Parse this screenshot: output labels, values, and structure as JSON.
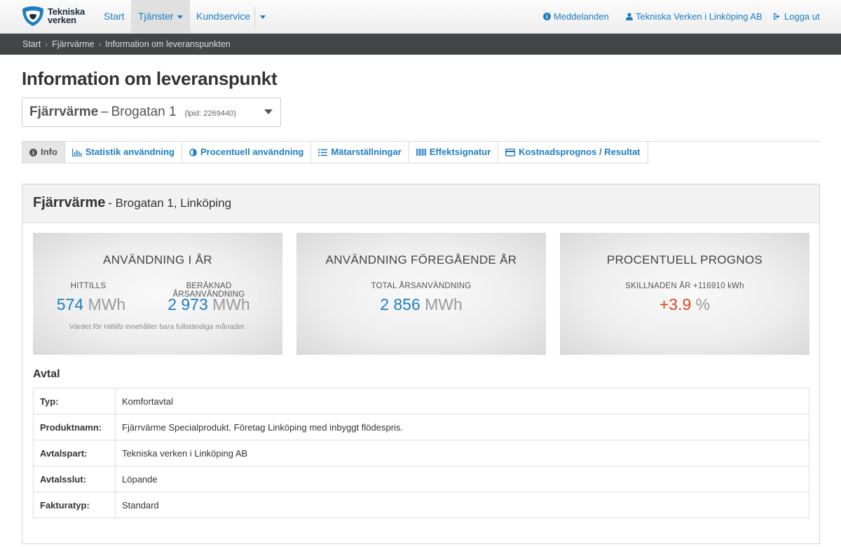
{
  "brand": {
    "logo_line1": "Tekniska",
    "logo_line2": "verken",
    "logo_colors": {
      "blue": "#1f7dc1",
      "dark": "#1b2a3c"
    }
  },
  "nav": {
    "start": "Start",
    "services": "Tjänster",
    "customer_service": "Kundservice",
    "messages": "Meddelanden",
    "account": "Tekniska Verken i Linköping AB",
    "logout": "Logga ut"
  },
  "breadcrumb": [
    "Start",
    "Fjärrvärme",
    "Information om leveranspunkten"
  ],
  "page": {
    "title": "Information om leveranspunkt",
    "selector": {
      "product": "Fjärrvärme",
      "dash": "–",
      "address": "Brogatan 1",
      "id_label": "(lpid: 2269440)"
    }
  },
  "tabs": [
    {
      "label": "Info",
      "icon": "info-icon",
      "active": true
    },
    {
      "label": "Statistik användning",
      "icon": "bar-chart-icon"
    },
    {
      "label": "Procentuell användning",
      "icon": "half-circle-icon"
    },
    {
      "label": "Mätarställningar",
      "icon": "list-icon"
    },
    {
      "label": "Effektsignatur",
      "icon": "barcode-icon"
    },
    {
      "label": "Kostnadsprognos / Resultat",
      "icon": "credit-card-icon"
    }
  ],
  "panel": {
    "title": "Fjärrvärme",
    "subtitle": "- Brogatan 1, Linköping"
  },
  "stats": {
    "current": {
      "title": "ANVÄNDNING I ÅR",
      "to_date_label": "HITTILLS",
      "to_date_value": "574",
      "to_date_unit": "MWh",
      "estimated_label": "BERÄKNAD ÅRSANVÄNDNING",
      "estimated_value": "2 973",
      "estimated_unit": "MWh",
      "note_prefix": "Värdet för",
      "note_em": "Hittills",
      "note_suffix": "innehåller bara fullständiga månader."
    },
    "previous": {
      "title": "ANVÄNDNING FÖREGÅENDE ÅR",
      "label": "TOTAL ÅRSANVÄNDNING",
      "value": "2 856",
      "unit": "MWh"
    },
    "forecast": {
      "title": "PROCENTUELL PROGNOS",
      "label": "SKILLNADEN ÅR +116910 kWh",
      "value": "+3.9",
      "unit": "%",
      "value_color": "#d9471c"
    }
  },
  "contract": {
    "heading": "Avtal",
    "rows": [
      {
        "key": "Typ:",
        "value": "Komfortavtal"
      },
      {
        "key": "Produktnamn:",
        "value": "Fjärrvärme Specialprodukt. Företag Linköping med inbyggt flödespris."
      },
      {
        "key": "Avtalspart:",
        "value": "Tekniska verken i Linköping AB"
      },
      {
        "key": "Avtalsslut:",
        "value": "Löpande"
      },
      {
        "key": "Fakturatyp:",
        "value": "Standard"
      }
    ]
  }
}
